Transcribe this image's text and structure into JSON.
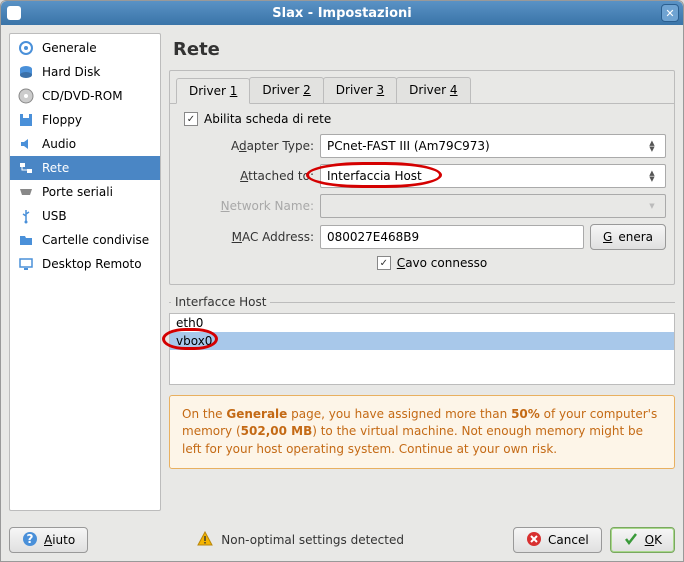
{
  "window": {
    "title": "Slax - Impostazioni"
  },
  "sidebar": {
    "items": [
      {
        "label": "Generale"
      },
      {
        "label": "Hard Disk"
      },
      {
        "label": "CD/DVD-ROM"
      },
      {
        "label": "Floppy"
      },
      {
        "label": "Audio"
      },
      {
        "label": "Rete"
      },
      {
        "label": "Porte seriali"
      },
      {
        "label": "USB"
      },
      {
        "label": "Cartelle condivise"
      },
      {
        "label": "Desktop Remoto"
      }
    ]
  },
  "main": {
    "heading": "Rete",
    "tabs": [
      {
        "label": "Driver 1"
      },
      {
        "label": "Driver 2"
      },
      {
        "label": "Driver 3"
      },
      {
        "label": "Driver 4"
      }
    ],
    "enable_label": "Abilita scheda di rete",
    "adapter_type_label": "Adapter Type:",
    "adapter_type_value": "PCnet-FAST III (Am79C973)",
    "attached_label": "Attached to:",
    "attached_value": "Interfaccia Host",
    "network_name_label": "Network Name:",
    "network_name_value": "",
    "mac_label": "MAC Address:",
    "mac_value": "080027E468B9",
    "generate_label": "Genera",
    "cable_label": "Cavo connesso",
    "hostif_label": "Interfacce Host",
    "hostif_items": [
      {
        "name": "eth0"
      },
      {
        "name": "vbox0"
      }
    ],
    "warning_html": "On the <b>Generale</b> page, you have assigned more than <b>50%</b> of your computer's memory (<b>502,00 MB</b>) to the virtual machine. Not enough memory might be left for your host operating system. Continue at your own risk."
  },
  "footer": {
    "help": "Aiuto",
    "status": "Non-optimal settings detected",
    "cancel": "Cancel",
    "ok": "OK"
  }
}
